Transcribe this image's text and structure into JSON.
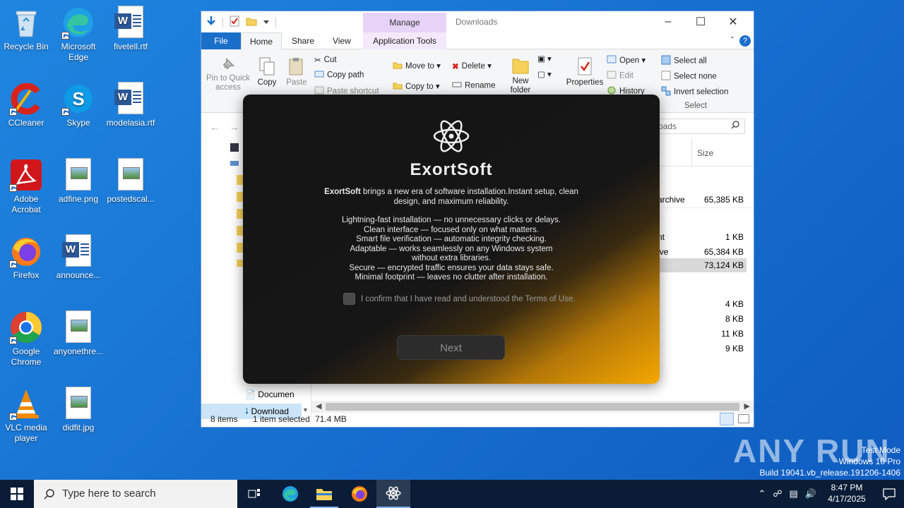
{
  "desktop_icons": [
    {
      "label": "Recycle Bin",
      "icon": "recycle-bin-icon"
    },
    {
      "label": "Microsoft Edge",
      "icon": "edge-icon"
    },
    {
      "label": "fivetell.rtf",
      "icon": "word-doc-icon"
    },
    {
      "label": "CCleaner",
      "icon": "ccleaner-icon"
    },
    {
      "label": "Skype",
      "icon": "skype-icon"
    },
    {
      "label": "modelasia.rtf",
      "icon": "word-doc-icon"
    },
    {
      "label": "Adobe Acrobat",
      "icon": "acrobat-icon"
    },
    {
      "label": "adfine.png",
      "icon": "image-file-icon"
    },
    {
      "label": "postedscal...",
      "icon": "image-file-icon"
    },
    {
      "label": "Firefox",
      "icon": "firefox-icon"
    },
    {
      "label": "announce...",
      "icon": "word-doc-icon"
    },
    {
      "label": "Google Chrome",
      "icon": "chrome-icon"
    },
    {
      "label": "anyonethre...",
      "icon": "image-file-icon"
    },
    {
      "label": "VLC media player",
      "icon": "vlc-icon"
    },
    {
      "label": "didfit.jpg",
      "icon": "image-file-icon"
    }
  ],
  "explorer": {
    "title": "Downloads",
    "manage_tab": "Manage",
    "tabs": {
      "file": "File",
      "home": "Home",
      "share": "Share",
      "view": "View",
      "app_tools": "Application Tools"
    },
    "ribbon": {
      "pin": "Pin to Quick access",
      "copy": "Copy",
      "paste": "Paste",
      "cut": "Cut",
      "copy_path": "Copy path",
      "paste_shortcut": "Paste shortcut",
      "move_to": "Move to",
      "copy_to": "Copy to",
      "delete": "Delete",
      "rename": "Rename",
      "new_folder": "New folder",
      "properties": "Properties",
      "open": "Open",
      "edit": "Edit",
      "history": "History",
      "select_all": "Select all",
      "select_none": "Select none",
      "invert_selection": "Invert selection",
      "select_group": "Select"
    },
    "search_placeholder": "oads",
    "column_size": "Size",
    "rows": [
      {
        "type": "archive",
        "size": "65,385 KB"
      },
      {
        "type": "nt",
        "size": "1 KB"
      },
      {
        "type": "ive",
        "size": "65,384 KB"
      },
      {
        "type": "",
        "size": "73,124 KB",
        "selected": true
      },
      {
        "type": "",
        "size": "4 KB"
      },
      {
        "type": "",
        "size": "8 KB"
      },
      {
        "type": "",
        "size": "11 KB"
      },
      {
        "type": "",
        "size": "9 KB"
      }
    ],
    "nav": {
      "documents": "Documen",
      "downloads": "Download"
    },
    "status": {
      "items": "8 items",
      "selected": "1 item selected",
      "size": "71.4 MB"
    }
  },
  "installer": {
    "brand": "ExortSoft",
    "intro_bold": "ExortSoft",
    "intro_rest": " brings a new era of software installation.Instant setup, clean design, and maximum reliability.",
    "features": [
      "Lightning-fast installation — no unnecessary clicks or delays.",
      "Clean interface — focused only on what matters.",
      "Smart file verification — automatic integrity checking.",
      "Adaptable — works seamlessly on any Windows system",
      "without extra libraries.",
      "Secure — encrypted traffic ensures your data stays safe.",
      "Minimal footprint — leaves no clutter after installation."
    ],
    "confirm_label": "I confirm that I have read and understood the Terms of Use.",
    "next_label": "Next"
  },
  "taskbar": {
    "search_placeholder": "Type here to search",
    "time": "8:47 PM",
    "date": "4/17/2025"
  },
  "watermark": {
    "line1": "Test Mode",
    "line2": "Windows 10 Pro",
    "line3": "Build 19041.vb_release.191206-1406",
    "brand": "ANY RUN"
  }
}
